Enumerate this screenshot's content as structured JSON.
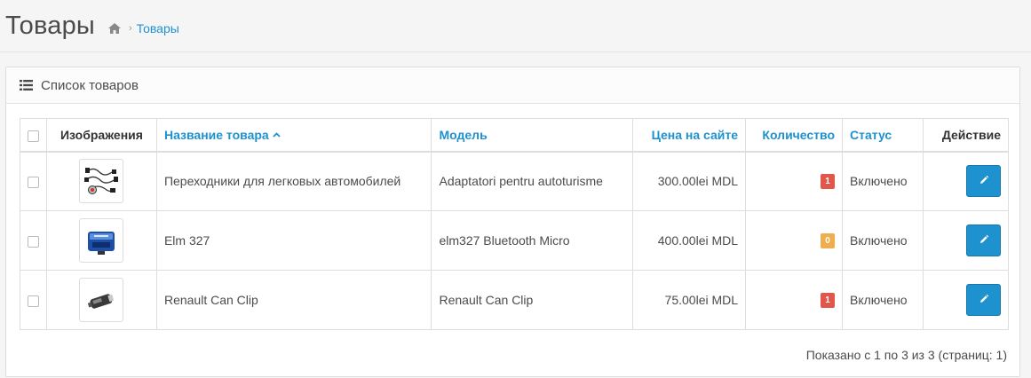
{
  "header": {
    "title": "Товары",
    "breadcrumb": [
      {
        "icon": "home-icon"
      },
      {
        "label": "Товары"
      }
    ]
  },
  "panel": {
    "title": "Список товаров",
    "icon": "list-icon"
  },
  "table": {
    "columns": {
      "image": "Изображения",
      "name": "Название товара",
      "model": "Модель",
      "price": "Цена на сайте",
      "quantity": "Количество",
      "status": "Статус",
      "action": "Действие"
    },
    "sort": {
      "column": "name",
      "direction": "asc",
      "indicator_icon": "caret-up-icon"
    },
    "rows": [
      {
        "image_icon": "cable-adapters-thumbnail",
        "name": "Переходники для легковых автомобилей",
        "model": "Adaptatori pentru autoturisme",
        "price": "300.00lei MDL",
        "quantity": "1",
        "quantity_status": "danger",
        "status": "Включено"
      },
      {
        "image_icon": "elm327-device-thumbnail",
        "name": "Elm 327",
        "model": "elm327 Bluetooth Micro",
        "price": "400.00lei MDL",
        "quantity": "0",
        "quantity_status": "warning",
        "status": "Включено"
      },
      {
        "image_icon": "can-clip-device-thumbnail",
        "name": "Renault Can Clip",
        "model": "Renault Can Clip",
        "price": "75.00lei MDL",
        "quantity": "1",
        "quantity_status": "danger",
        "status": "Включено"
      }
    ],
    "action_icon": "pencil-icon"
  },
  "pagination": {
    "summary": "Показано с 1 по 3 из 3 (страниц: 1)"
  },
  "colors": {
    "accent": "#1e91cf",
    "badge_danger": "#e2574c",
    "badge_warning": "#f0ad4e"
  }
}
